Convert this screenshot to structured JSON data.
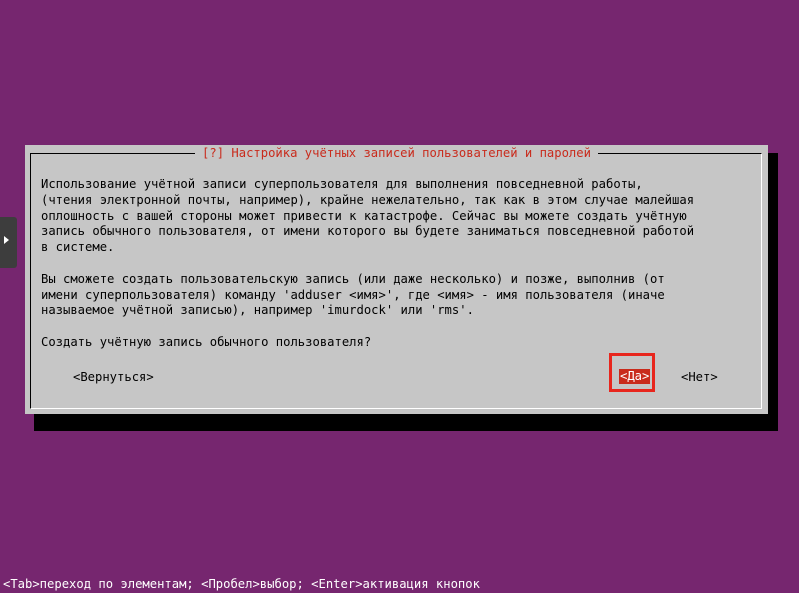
{
  "dialog": {
    "title": "[?] Настройка учётных записей пользователей и паролей",
    "paragraph1": "Использование учётной записи суперпользователя для выполнения повседневной работы,\n(чтения электронной почты, например), крайне нежелательно, так как в этом случае малейшая\nоплошность с вашей стороны может привести к катастрофе. Сейчас вы можете создать учётную\nзапись обычного пользователя, от имени которого вы будете заниматься повседневной работой\nв системе.",
    "paragraph2": "Вы сможете создать пользовательскую запись (или даже несколько) и позже, выполнив (от\nимени суперпользователя) команду 'adduser <имя>', где <имя> - имя пользователя (иначе\nназываемое учётной записью), например 'imurdock' или 'rms'.",
    "question": "Создать учётную запись обычного пользователя?",
    "buttons": {
      "back": "<Вернуться>",
      "yes": "<Да>",
      "no": "<Нет>"
    }
  },
  "hint_bar": "<Tab>переход по элементам; <Пробел>выбор; <Enter>активация кнопок",
  "icons": {
    "side_tab": "triangle-right-icon"
  },
  "colors": {
    "background": "#76266f",
    "dialog": "#c6c6c6",
    "accent": "#c92b1c",
    "highlight_box": "#e8261d"
  }
}
